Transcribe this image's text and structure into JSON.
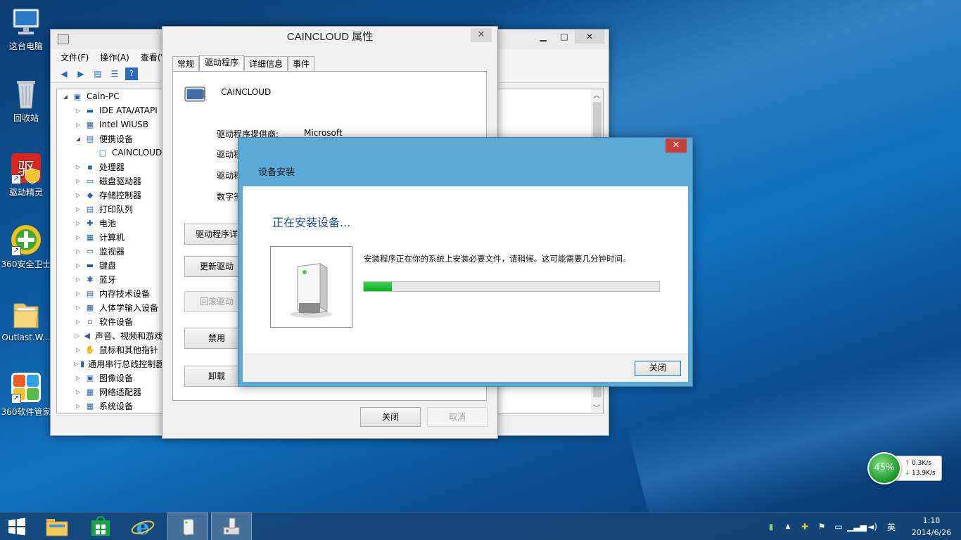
{
  "desktop": {
    "icons": [
      {
        "label": "这台电脑"
      },
      {
        "label": "回收站"
      },
      {
        "label": "驱动精灵"
      },
      {
        "label": "360安全卫士"
      },
      {
        "label": "Outlast.W..."
      },
      {
        "label": "360软件管家"
      }
    ]
  },
  "device_manager": {
    "menu": [
      "文件(F)",
      "操作(A)",
      "查看(V)"
    ],
    "tree": [
      {
        "label": "Cain-PC",
        "level": 0,
        "expander": "◢"
      },
      {
        "label": "IDE ATA/ATAPI",
        "level": 1,
        "expander": "▷"
      },
      {
        "label": "Intel WiUSB",
        "level": 1,
        "expander": "▷"
      },
      {
        "label": "便携设备",
        "level": 1,
        "expander": "◢"
      },
      {
        "label": "CAINCLOUD",
        "level": 2,
        "expander": ""
      },
      {
        "label": "处理器",
        "level": 1,
        "expander": "▷"
      },
      {
        "label": "磁盘驱动器",
        "level": 1,
        "expander": "▷"
      },
      {
        "label": "存储控制器",
        "level": 1,
        "expander": "▷"
      },
      {
        "label": "打印队列",
        "level": 1,
        "expander": "▷"
      },
      {
        "label": "电池",
        "level": 1,
        "expander": "▷"
      },
      {
        "label": "计算机",
        "level": 1,
        "expander": "▷"
      },
      {
        "label": "监视器",
        "level": 1,
        "expander": "▷"
      },
      {
        "label": "键盘",
        "level": 1,
        "expander": "▷"
      },
      {
        "label": "蓝牙",
        "level": 1,
        "expander": "▷"
      },
      {
        "label": "内存技术设备",
        "level": 1,
        "expander": "▷"
      },
      {
        "label": "人体学输入设备",
        "level": 1,
        "expander": "▷"
      },
      {
        "label": "软件设备",
        "level": 1,
        "expander": "▷"
      },
      {
        "label": "声音、视频和游戏",
        "level": 1,
        "expander": "▷"
      },
      {
        "label": "鼠标和其他指针",
        "level": 1,
        "expander": "▷"
      },
      {
        "label": "通用串行总线控制器",
        "level": 1,
        "expander": "▷"
      },
      {
        "label": "图像设备",
        "level": 1,
        "expander": "▷"
      },
      {
        "label": "网络适配器",
        "level": 1,
        "expander": "▷"
      },
      {
        "label": "系统设备",
        "level": 1,
        "expander": "▷"
      }
    ]
  },
  "properties": {
    "title": "CAINCLOUD 属性",
    "close_glyph": "✕",
    "tabs": [
      "常规",
      "驱动程序",
      "详细信息",
      "事件"
    ],
    "device_name": "CAINCLOUD",
    "rows": [
      {
        "label": "驱动程序提供商:",
        "value": "Microsoft"
      },
      {
        "label": "驱动程",
        "value": ""
      },
      {
        "label": "驱动程",
        "value": ""
      },
      {
        "label": "数字签",
        "value": ""
      }
    ],
    "buttons": [
      {
        "label": "驱动程序详",
        "disabled": false
      },
      {
        "label": "更新驱动",
        "disabled": false
      },
      {
        "label": "回滚驱动",
        "disabled": true
      },
      {
        "label": "禁用",
        "disabled": false
      },
      {
        "label": "卸载",
        "disabled": false
      }
    ],
    "ok_label": "关闭",
    "cancel_label": "取消"
  },
  "install_dialog": {
    "title": "设备安装",
    "close_glyph": "✕",
    "heading": "正在安装设备...",
    "message": "安装程序正在你的系统上安装必要文件，请稍候。这可能需要几分钟时间。",
    "progress": 0.095,
    "close_label": "关闭"
  },
  "net_widget": {
    "percent": "45%",
    "up": "0.3K/s",
    "down": "13.9K/s"
  },
  "tray": {
    "ime": "英",
    "time": "1:18",
    "date": "2014/6/26"
  },
  "colors": {
    "progress": "#06b025",
    "dialog_accent": "#5aa9d6",
    "close_red": "#c7413a"
  }
}
